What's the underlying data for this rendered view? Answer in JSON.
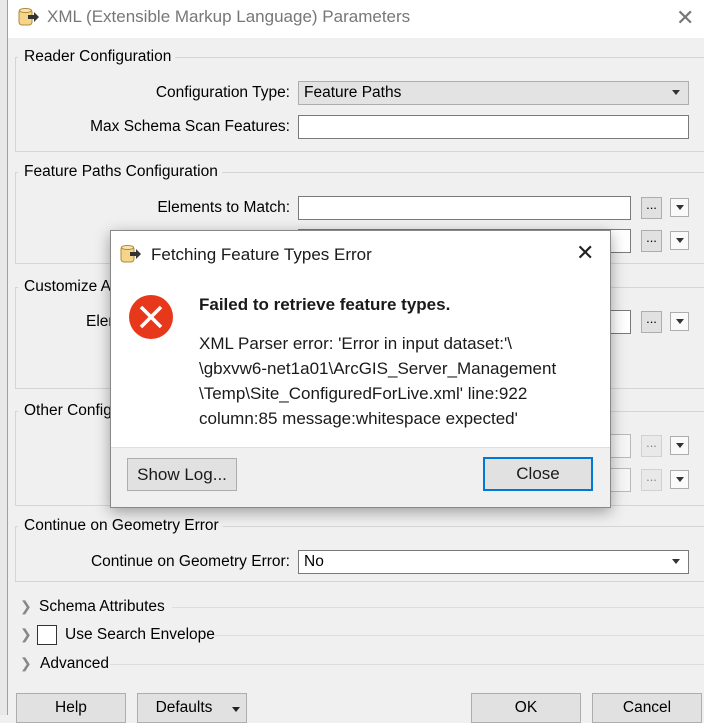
{
  "window": {
    "title": "XML (Extensible Markup Language) Parameters",
    "close_icon": "close-icon"
  },
  "reader_config": {
    "title": "Reader Configuration",
    "configuration_type_label": "Configuration Type:",
    "configuration_type_value": "Feature Paths",
    "max_schema_label": "Max Schema Scan Features:",
    "max_schema_value": ""
  },
  "feature_paths": {
    "title": "Feature Paths Configuration",
    "elements_label": "Elements to Match:",
    "elements_value": "",
    "dots": "..."
  },
  "customize": {
    "title": "Customize A",
    "row_label": "Elem"
  },
  "other": {
    "title": "Other Config"
  },
  "geometry": {
    "title": "Continue on Geometry Error",
    "label": "Continue on Geometry Error:",
    "value": "No"
  },
  "collapsibles": {
    "schema": "Schema Attributes",
    "envelope": "Use Search Envelope",
    "envelope_checked": false,
    "advanced": "Advanced"
  },
  "buttons": {
    "help": "Help",
    "defaults": "Defaults",
    "ok": "OK",
    "cancel": "Cancel"
  },
  "dialog": {
    "title": "Fetching Feature Types Error",
    "heading": "Failed to retrieve feature types.",
    "lines": [
      "XML Parser error: 'Error in input dataset:'\\",
      "\\gbxvw6-net1a01\\ArcGIS_Server_Management",
      "\\Temp\\Site_ConfiguredForLive.xml' line:922",
      "column:85 message:whitespace expected'"
    ],
    "show_log": "Show Log...",
    "close": "Close",
    "error_color": "#e8381c",
    "focus_color": "#0078d7"
  }
}
